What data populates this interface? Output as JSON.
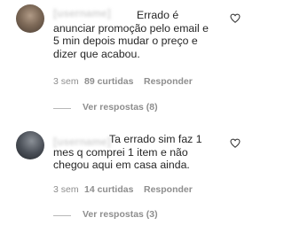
{
  "comments": [
    {
      "username": "[username]",
      "text_lines": [
        "Errado é",
        "anunciar promoção pelo email e",
        "5 min depois mudar o preço e",
        "dizer que acabou."
      ],
      "time": "3 sem",
      "likes": "89 curtidas",
      "reply": "Responder",
      "view_replies": "Ver respostas (8)"
    },
    {
      "username": "[username]",
      "text_lines": [
        "Ta errado sim faz 1",
        "mes q comprei 1 item e não",
        "chegou aqui em casa ainda."
      ],
      "time": "3 sem",
      "likes": "14 curtidas",
      "reply": "Responder",
      "view_replies": "Ver respostas (3)"
    }
  ],
  "icons": {
    "like": "heart-outline-icon"
  },
  "colors": {
    "text": "#262626",
    "secondary": "#8e8e8e",
    "background": "#ffffff"
  }
}
